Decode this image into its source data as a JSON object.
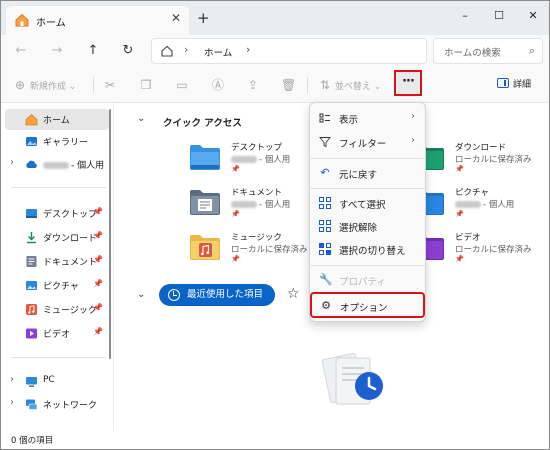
{
  "window": {
    "tab_title": "ホーム",
    "new_tab": "+",
    "controls": [
      "–",
      "☐",
      "✕"
    ]
  },
  "address": {
    "path": "ホーム",
    "search_placeholder": "ホームの検索"
  },
  "toolbar": {
    "new_label": "新規作成",
    "sort_label": "並べ替え",
    "more_label": "···",
    "details_label": "詳細"
  },
  "sidebar": {
    "items": [
      {
        "label": "ホーム",
        "icon": "home-icon",
        "color": "#e37b2f"
      },
      {
        "label": "ギャラリー",
        "icon": "gallery-icon",
        "color": "#2173d1"
      },
      {
        "label": "- 個人用",
        "icon": "onedrive-icon",
        "color": "#1a6fd2"
      },
      {
        "label": "デスクトップ",
        "icon": "desktop-icon",
        "color": "#2c88d9"
      },
      {
        "label": "ダウンロード",
        "icon": "download-icon",
        "color": "#1a8f5c"
      },
      {
        "label": "ドキュメント",
        "icon": "documents-icon",
        "color": "#6f7e92"
      },
      {
        "label": "ピクチャ",
        "icon": "pictures-icon",
        "color": "#2a86e0"
      },
      {
        "label": "ミュージック",
        "icon": "music-icon",
        "color": "#e0553b"
      },
      {
        "label": "ビデオ",
        "icon": "videos-icon",
        "color": "#8a3fd1"
      },
      {
        "label": "PC",
        "icon": "pc-icon",
        "color": "#2c88d9"
      },
      {
        "label": "ネットワーク",
        "icon": "network-icon",
        "color": "#2c88d9"
      }
    ]
  },
  "main": {
    "quick_access_title": "クイック アクセス",
    "quick_access": [
      {
        "name": "デスクトップ",
        "sub": "- 個人用",
        "color": "#3592e0"
      },
      {
        "name": "ドキュメント",
        "sub": "- 個人用",
        "color": "#6f7e92"
      },
      {
        "name": "ミュージック",
        "sub": "ローカルに保存済み",
        "color": "#e0553b"
      },
      {
        "name": "ダウンロード",
        "sub": "ローカルに保存済み",
        "color": "#1a8f5c"
      },
      {
        "name": "ピクチャ",
        "sub": "- 個人用",
        "color": "#2a86e0"
      },
      {
        "name": "ビデオ",
        "sub": "ローカルに保存済み",
        "color": "#8a3fd1"
      }
    ],
    "recent_label": "最近使用した項目"
  },
  "menu": {
    "items": [
      {
        "label": "表示",
        "icon": "view-icon",
        "submenu": true
      },
      {
        "label": "フィルター",
        "icon": "filter-icon",
        "submenu": true
      },
      {
        "label": "元に戻す",
        "icon": "undo-icon"
      },
      {
        "label": "すべて選択",
        "icon": "select-all-icon"
      },
      {
        "label": "選択解除",
        "icon": "select-none-icon"
      },
      {
        "label": "選択の切り替え",
        "icon": "invert-selection-icon"
      },
      {
        "label": "プロパティ",
        "icon": "properties-icon",
        "disabled": true
      },
      {
        "label": "オプション",
        "icon": "options-gear-icon",
        "highlighted": true
      }
    ]
  },
  "status": {
    "text": "0 個の項目"
  },
  "colors": {
    "accent": "#0a64c8",
    "highlight_border": "#d6141d"
  }
}
